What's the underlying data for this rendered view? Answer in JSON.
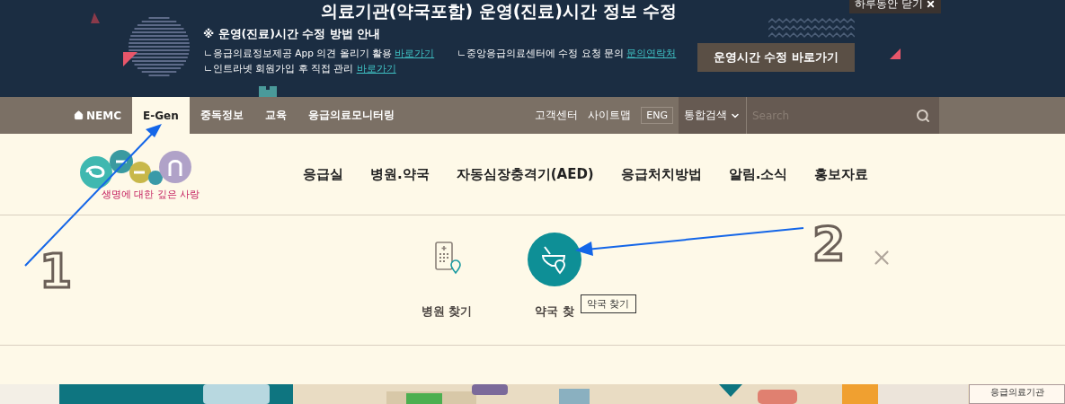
{
  "banner": {
    "title": "의료기관(약국포함) 운영(진료)시간 정보 수정",
    "close_today": "하루동안 닫기",
    "guide_heading": "※ 운영(진료)시간 수정 방법 안내",
    "guide_items": [
      {
        "text": "ㄴ응급의료정보제공 App 의견 올리기 활용 ",
        "link": "바로가기"
      },
      {
        "text": "ㄴ중앙응급의료센터에 수정 요청 문의 ",
        "link": "문의연락처"
      },
      {
        "text": "ㄴ인트라넷 회원가입 후 직접 관리 ",
        "link": "바로가기"
      }
    ],
    "button": "운영시간 수정 바로가기"
  },
  "top_nav": {
    "items": [
      {
        "label": "NEMC",
        "kind": "home",
        "selected": false
      },
      {
        "label": "E-Gen",
        "kind": "plain",
        "selected": true
      },
      {
        "label": "중독정보",
        "kind": "plain",
        "selected": false
      },
      {
        "label": "교육",
        "kind": "plain",
        "selected": false
      },
      {
        "label": "응급의료모니터링",
        "kind": "plain",
        "selected": false
      }
    ],
    "utility": [
      "고객센터",
      "사이트맵"
    ],
    "language": "ENG",
    "search_scope": "통합검색",
    "search": {
      "placeholder": "Search"
    }
  },
  "logo": {
    "tagline": "생명에 대한 깊은 사랑"
  },
  "main_menu": [
    "응급실",
    "병원.약국",
    "자동심장충격기(AED)",
    "응급처치방법",
    "알림.소식",
    "홍보자료"
  ],
  "quick_menu": {
    "items": [
      {
        "label": "병원 찾기",
        "kind": "hospital",
        "selected": false
      },
      {
        "label": "약국 찾",
        "kind": "pharmacy",
        "selected": true
      }
    ],
    "tooltip": "약국 찾기"
  },
  "annotations": [
    {
      "label": "1"
    },
    {
      "label": "2"
    }
  ],
  "footer_badge": "응급의료기관"
}
